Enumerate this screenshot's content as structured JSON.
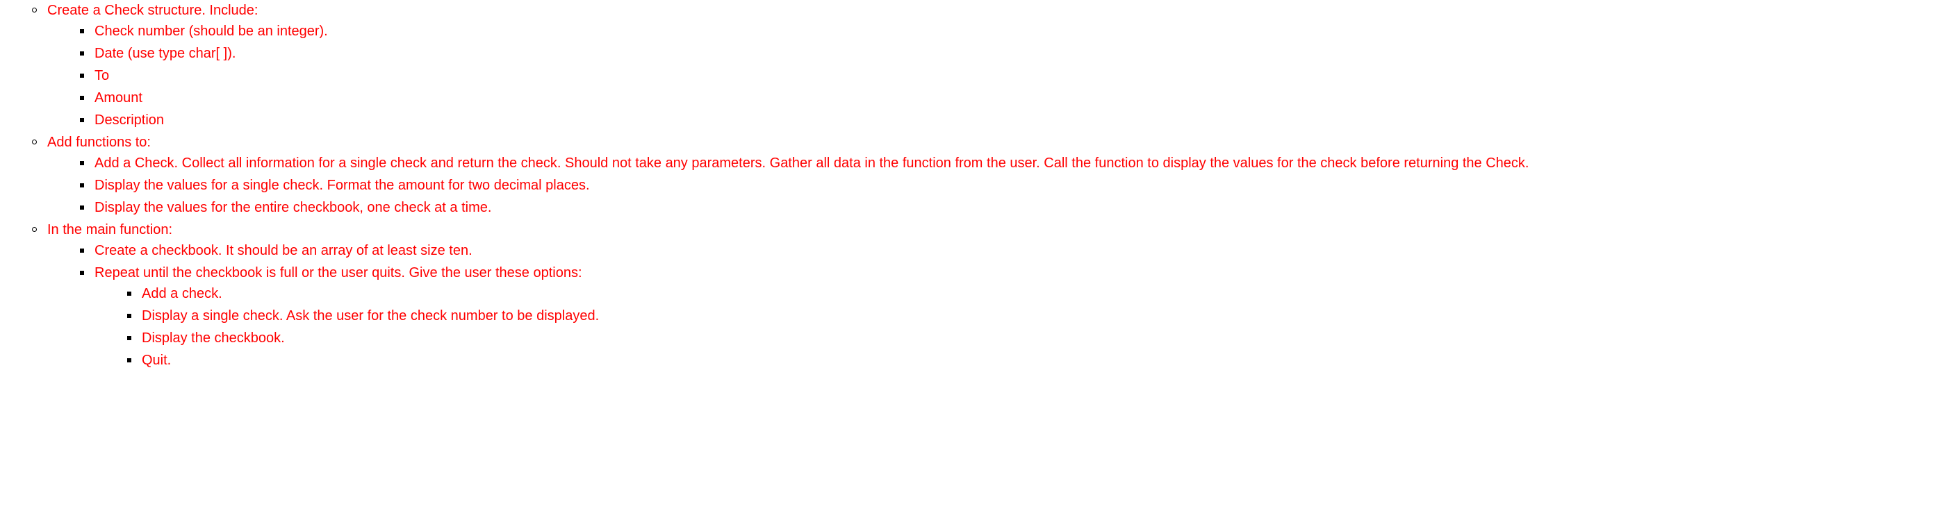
{
  "items": [
    {
      "text": "Create a Check structure.  Include:",
      "children": [
        {
          "text": "Check number (should be an integer)."
        },
        {
          "text": "Date (use type char[ ])."
        },
        {
          "text": "To"
        },
        {
          "text": "Amount"
        },
        {
          "text": "Description"
        }
      ]
    },
    {
      "text": " Add functions to:",
      "children": [
        {
          "text": "Add a Check. Collect all information for a single check and return the check. Should not take any parameters. Gather all data in the function from the user.  Call the function to display the values for the check before returning the Check."
        },
        {
          "text": "Display the values for a single check.  Format the amount for two decimal places."
        },
        {
          "text": "Display the values for the entire checkbook, one check at a time."
        }
      ]
    },
    {
      "text": "In the main function:",
      "children": [
        {
          "text": "Create a checkbook.  It should be an array of at least size ten."
        },
        {
          "text": "Repeat until the checkbook is full or the user quits.  Give the user these options:",
          "children": [
            {
              "text": "Add a check."
            },
            {
              "text": "Display a single check.  Ask the user for the check number to be displayed."
            },
            {
              "text": "Display the checkbook."
            },
            {
              "text": "Quit."
            }
          ]
        }
      ]
    }
  ]
}
